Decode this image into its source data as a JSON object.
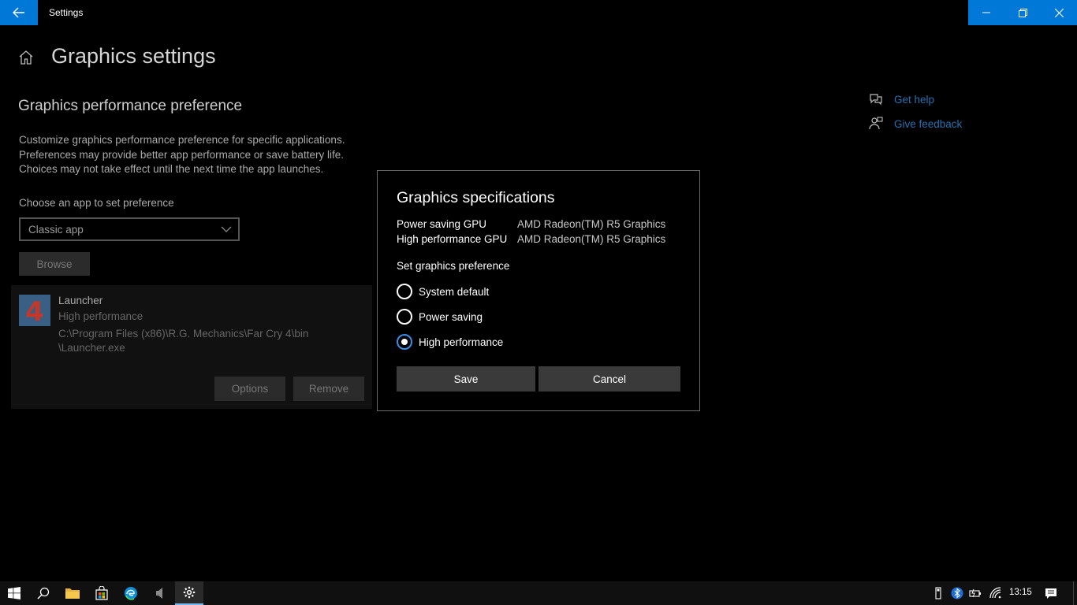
{
  "window": {
    "title": "Settings"
  },
  "page": {
    "title": "Graphics settings",
    "section_title": "Graphics performance preference",
    "description": [
      "Customize graphics performance preference for specific applications.",
      "Preferences may provide better app performance or save battery life.",
      "Choices may not take effect until the next time the app launches."
    ],
    "choose_label": "Choose an app to set preference",
    "dropdown_value": "Classic app",
    "browse_label": "Browse"
  },
  "app_entry": {
    "name": "Launcher",
    "preference": "High performance",
    "path": [
      "C:\\Program Files (x86)\\R.G. Mechanics\\Far Cry 4\\bin",
      "\\Launcher.exe"
    ],
    "icon_glyph": "4",
    "options_label": "Options",
    "remove_label": "Remove"
  },
  "help_links": {
    "get_help": "Get help",
    "give_feedback": "Give feedback"
  },
  "dialog": {
    "title": "Graphics specifications",
    "specs": [
      {
        "label": "Power saving GPU",
        "value": "AMD Radeon(TM) R5 Graphics"
      },
      {
        "label": "High performance GPU",
        "value": "AMD Radeon(TM) R5 Graphics"
      }
    ],
    "set_pref_label": "Set graphics preference",
    "options": [
      {
        "label": "System default",
        "selected": false
      },
      {
        "label": "Power saving",
        "selected": false
      },
      {
        "label": "High performance",
        "selected": true
      }
    ],
    "save_label": "Save",
    "cancel_label": "Cancel"
  },
  "taskbar": {
    "clock": "13:15",
    "accent": "#0078d7"
  }
}
